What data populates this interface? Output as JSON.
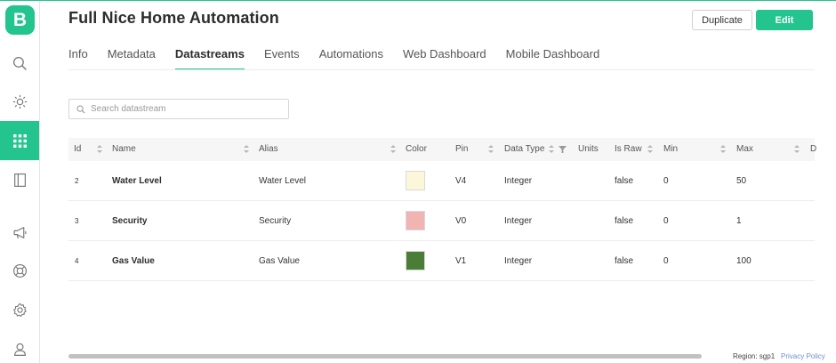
{
  "app": {
    "logo_letter": "B",
    "accent": "#23c48e"
  },
  "sidebar": {
    "items": [
      {
        "icon": "search-icon"
      },
      {
        "icon": "sun-icon"
      },
      {
        "icon": "grid-icon",
        "active": true
      },
      {
        "icon": "book-icon"
      },
      {
        "icon": "megaphone-icon"
      },
      {
        "icon": "lifebuoy-icon"
      },
      {
        "icon": "gear-icon"
      },
      {
        "icon": "user-icon"
      }
    ]
  },
  "header": {
    "title": "Full Nice Home Automation",
    "duplicate_label": "Duplicate",
    "edit_label": "Edit"
  },
  "tabs": [
    {
      "label": "Info"
    },
    {
      "label": "Metadata"
    },
    {
      "label": "Datastreams",
      "active": true
    },
    {
      "label": "Events"
    },
    {
      "label": "Automations"
    },
    {
      "label": "Web Dashboard"
    },
    {
      "label": "Mobile Dashboard"
    }
  ],
  "search": {
    "placeholder": "Search datastream",
    "value": ""
  },
  "table": {
    "columns": [
      "Id",
      "Name",
      "Alias",
      "Color",
      "Pin",
      "Data Type",
      "Units",
      "Is Raw",
      "Min",
      "Max",
      "D"
    ],
    "rows": [
      {
        "id": "2",
        "name": "Water Level",
        "alias": "Water Level",
        "color": "#fdf7d9",
        "pin": "V4",
        "data_type": "Integer",
        "units": "",
        "is_raw": "false",
        "min": "0",
        "max": "50"
      },
      {
        "id": "3",
        "name": "Security",
        "alias": "Security",
        "color": "#f2b3b3",
        "pin": "V0",
        "data_type": "Integer",
        "units": "",
        "is_raw": "false",
        "min": "0",
        "max": "1"
      },
      {
        "id": "4",
        "name": "Gas Value",
        "alias": "Gas Value",
        "color": "#4a7d35",
        "pin": "V1",
        "data_type": "Integer",
        "units": "",
        "is_raw": "false",
        "min": "0",
        "max": "100"
      }
    ]
  },
  "footer": {
    "region": "Region: sgp1",
    "privacy": "Privacy Policy"
  }
}
